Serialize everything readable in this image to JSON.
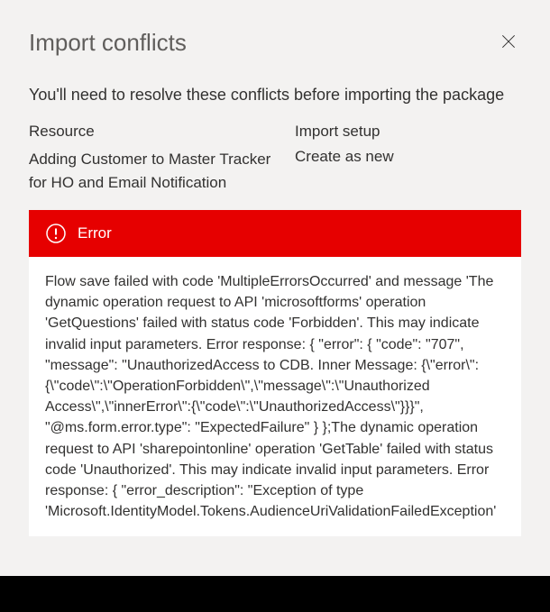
{
  "dialog": {
    "title": "Import conflicts",
    "subtitle": "You'll need to resolve these conflicts before importing the package"
  },
  "table": {
    "headers": {
      "resource": "Resource",
      "import_setup": "Import setup"
    },
    "rows": [
      {
        "resource": "Adding Customer to Master Tracker for HO and Email Notification",
        "import_setup": "Create as new"
      }
    ]
  },
  "error": {
    "label": "Error",
    "message": "Flow save failed with code 'MultipleErrorsOccurred' and message 'The dynamic operation request to API 'microsoftforms' operation 'GetQuestions' failed with status code 'Forbidden'. This may indicate invalid input parameters. Error response: { \"error\": { \"code\": \"707\", \"message\": \"UnauthorizedAccess to CDB. Inner Message: {\\\"error\\\":{\\\"code\\\":\\\"OperationForbidden\\\",\\\"message\\\":\\\"Unauthorized Access\\\",\\\"innerError\\\":{\\\"code\\\":\\\"UnauthorizedAccess\\\"}}}\", \"@ms.form.error.type\": \"ExpectedFailure\" } };The dynamic operation request to API 'sharepointonline' operation 'GetTable' failed with status code 'Unauthorized'. This may indicate invalid input parameters. Error response: { \"error_description\": \"Exception of type 'Microsoft.IdentityModel.Tokens.AudienceUriValidationFailedException'"
  }
}
